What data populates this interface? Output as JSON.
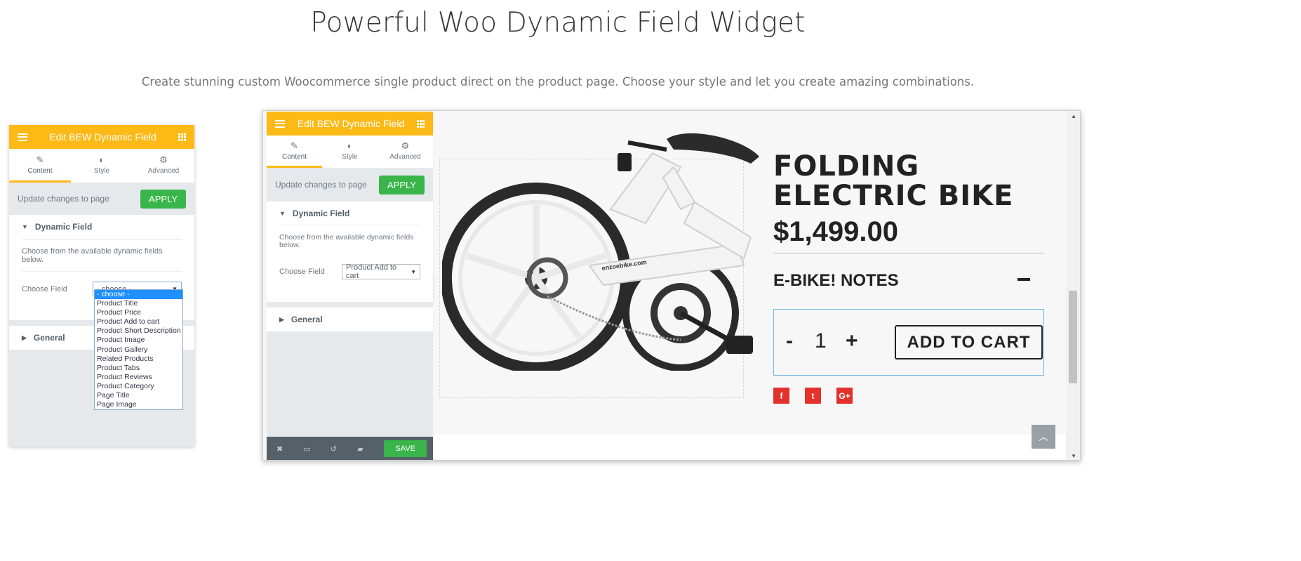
{
  "page": {
    "headline": "Powerful Woo Dynamic Field Widget",
    "subline": "Create stunning custom Woocommerce single product direct on the product page. Choose your style and let you create amazing combinations."
  },
  "editor": {
    "title": "Edit BEW Dynamic Field",
    "tabs": [
      "Content",
      "Style",
      "Advanced"
    ],
    "update_text": "Update changes to page",
    "apply_label": "APPLY",
    "section_dynamic": "Dynamic Field",
    "description_left": "Choose from the available dynamic fields below.",
    "description_right": "Choose from the available dynamic fields below.",
    "choose_field_label": "Choose Field",
    "section_general": "General",
    "save_label": "SAVE"
  },
  "left_select": {
    "value": "- choose -",
    "options": [
      "- choose -",
      "Product Title",
      "Product Price",
      "Product Add to cart",
      "Product Short Description",
      "Product Image",
      "Product Gallery",
      "Related Products",
      "Product Tabs",
      "Product Reviews",
      "Product Category",
      "Page Title",
      "Page Image"
    ]
  },
  "right_select": {
    "value": "Product Add to cart"
  },
  "product": {
    "title_line1": "FOLDING",
    "title_line2": "ELECTRIC BIKE",
    "price": "$1,499.00",
    "notes": "E-BIKE! NOTES",
    "qty_minus": "-",
    "qty": "1",
    "qty_plus": "+",
    "add_to_cart": "ADD TO CART",
    "bike_brand_text": "enzoebike.com",
    "social": [
      "f",
      "t",
      "G+"
    ]
  },
  "colors": {
    "header_accent": "#fdb915",
    "apply_green": "#39b54a",
    "social_red": "#e4312b",
    "select_highlight": "#1e90ff"
  },
  "icons": {
    "menu": "hamburger-icon",
    "apps": "grid-icon",
    "content": "pencil-icon",
    "style": "half-circle-icon",
    "advanced": "gear-icon",
    "footer": [
      "close-icon",
      "desktop-icon",
      "history-icon",
      "folder-icon"
    ]
  }
}
